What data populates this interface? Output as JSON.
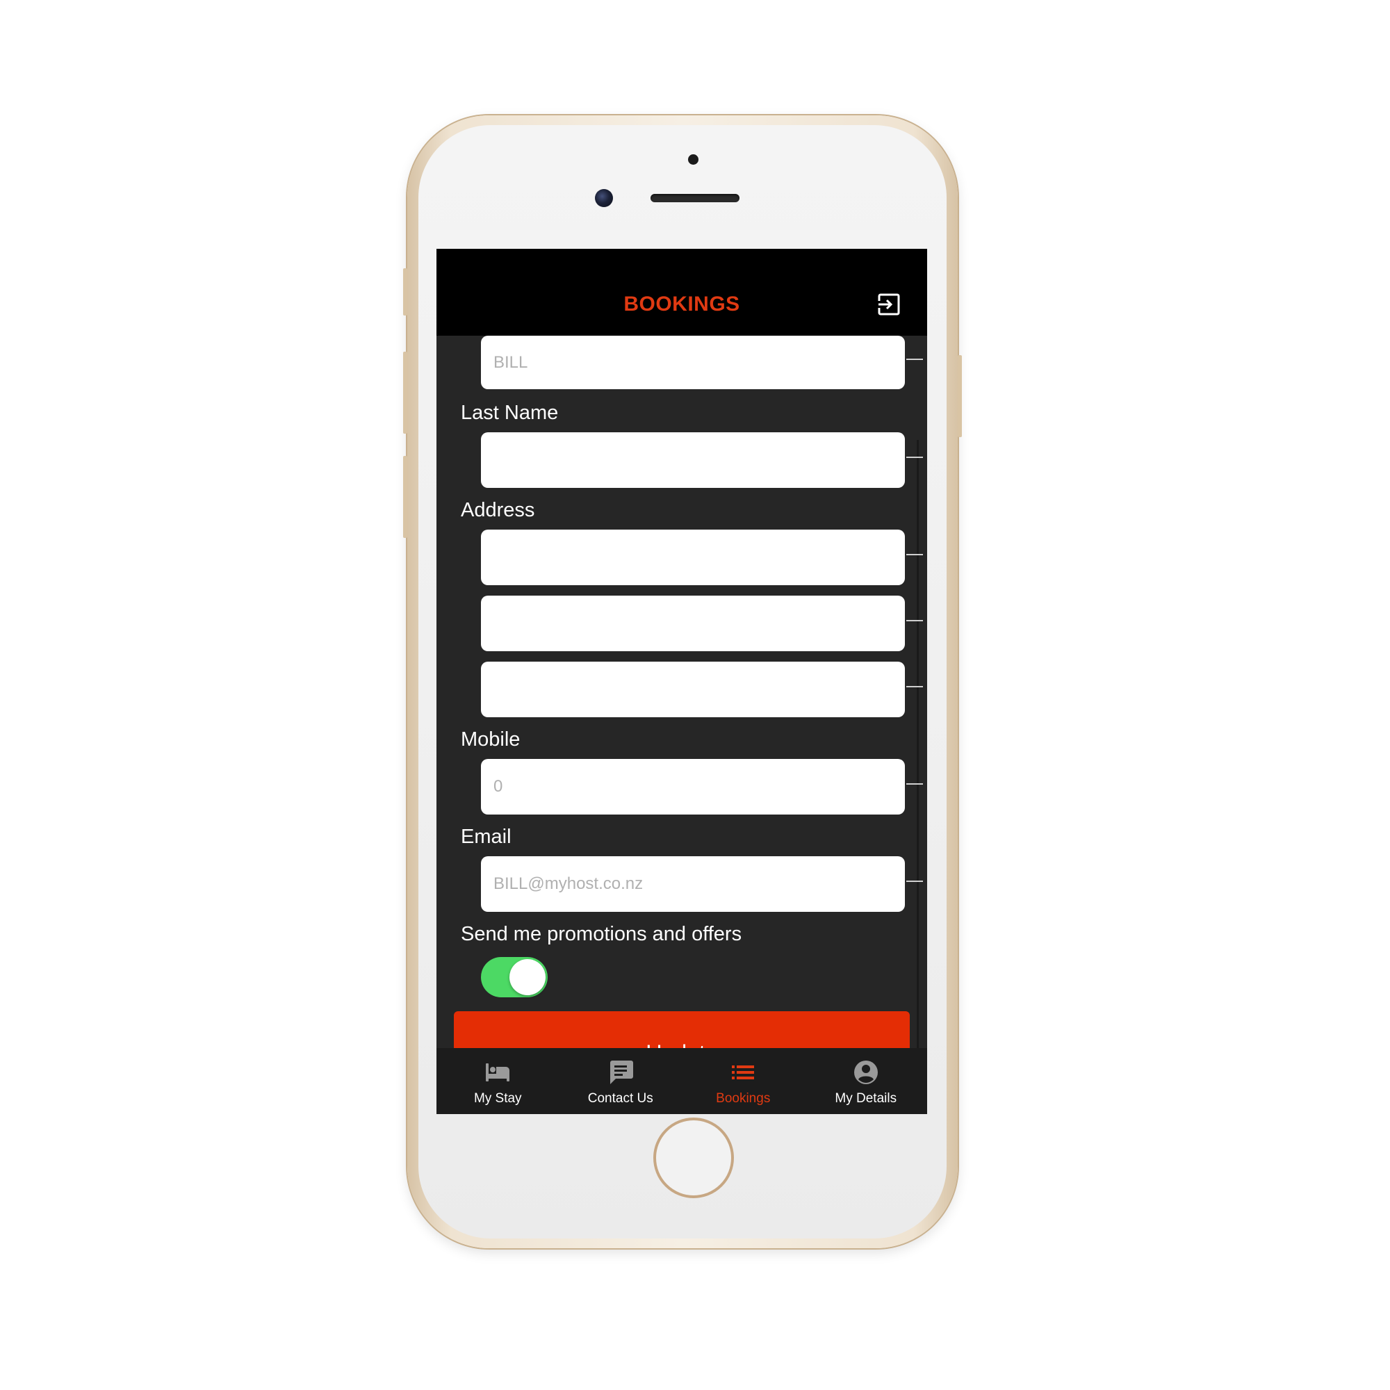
{
  "colors": {
    "accent": "#e03a12",
    "button": "#e42d05",
    "toggle_on": "#4cd964",
    "tab_inactive": "#9a9a9a",
    "tab_label": "#ffffff"
  },
  "header": {
    "title": "BOOKINGS",
    "logout_icon": "logout-icon"
  },
  "form": {
    "first_name": {
      "value": "",
      "placeholder": "BILL"
    },
    "last_name": {
      "label": "Last Name",
      "value": "",
      "placeholder": ""
    },
    "address": {
      "label": "Address",
      "line1": {
        "value": "",
        "placeholder": ""
      },
      "line2": {
        "value": "",
        "placeholder": ""
      },
      "line3": {
        "value": "",
        "placeholder": ""
      }
    },
    "mobile": {
      "label": "Mobile",
      "value": "",
      "placeholder": "0"
    },
    "email": {
      "label": "Email",
      "value": "",
      "placeholder": "BILL@myhost.co.nz"
    },
    "promotions": {
      "label": "Send me promotions and offers",
      "enabled": true
    },
    "update_label": "Update"
  },
  "tabs": [
    {
      "label": "My Stay",
      "icon": "bed-icon",
      "active": false
    },
    {
      "label": "Contact Us",
      "icon": "chat-icon",
      "active": false
    },
    {
      "label": "Bookings",
      "icon": "list-icon",
      "active": true
    },
    {
      "label": "My Details",
      "icon": "account-circle-icon",
      "active": false
    }
  ]
}
